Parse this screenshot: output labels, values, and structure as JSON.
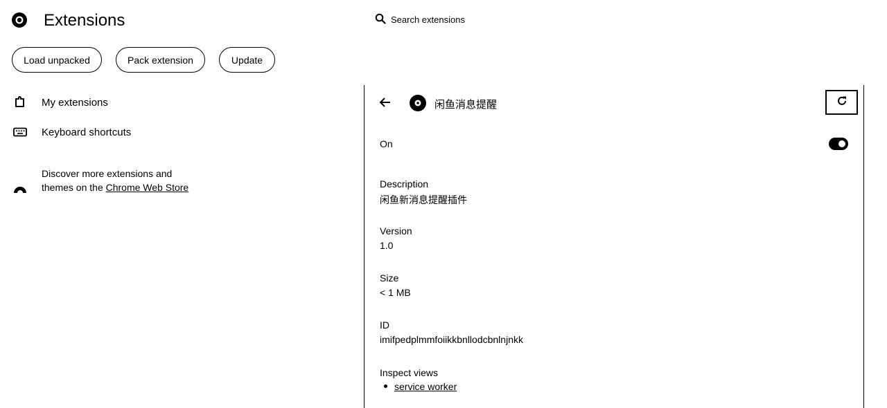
{
  "app": {
    "title": "Extensions"
  },
  "search": {
    "placeholder": "Search extensions"
  },
  "toolbar": {
    "load_unpacked": "Load unpacked",
    "pack_extension": "Pack extension",
    "update": "Update"
  },
  "sidebar": {
    "items": [
      {
        "label": "My extensions",
        "icon": "puzzle-icon"
      },
      {
        "label": "Keyboard shortcuts",
        "icon": "keyboard-icon"
      }
    ],
    "discover": {
      "text": "Discover more extensions and themes on the ",
      "link": "Chrome Web Store",
      "icon": "chrome-web-store-icon"
    }
  },
  "detail": {
    "name": "闲鱼消息提醒",
    "on_label": "On",
    "enabled": true,
    "description_label": "Description",
    "description": "闲鱼新消息提醒插件",
    "version_label": "Version",
    "version": "1.0",
    "size_label": "Size",
    "size": "< 1 MB",
    "id_label": "ID",
    "id": "imifpedplmmfoiikkbnllodcbnlnjnkk",
    "inspect_label": "Inspect views",
    "inspect_link": "service worker"
  }
}
